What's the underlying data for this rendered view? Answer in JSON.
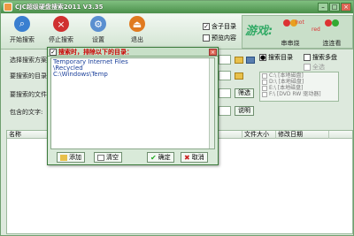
{
  "window": {
    "title": "CJC超级硬盘搜索2011 V3.35",
    "min": "–",
    "max": "□",
    "close": "×"
  },
  "toolbar": {
    "start": "开始搜索",
    "stop": "停止搜索",
    "settings": "设置",
    "exit": "退出"
  },
  "options": {
    "subdir": "含子目录",
    "preview": "预览内容"
  },
  "games": {
    "title": "游戏:",
    "item1": "串串烧",
    "item2": "连连看",
    "hot_badge": "hot",
    "red_badge": "red"
  },
  "form": {
    "scheme_label": "选择搜索方案:",
    "dir_label": "要搜索的目录:",
    "file_label": "要搜索的文件:",
    "text_label": "包含的文字:",
    "filter_btn": "筛选",
    "explain_btn": "说明"
  },
  "right": {
    "search_dir": "搜索目录",
    "search_multi": "搜索多盘",
    "select_all": "全选",
    "drives": [
      "C:\\ [本地磁盘]",
      "D:\\ [本地磁盘]",
      "E:\\ [本地磁盘]",
      "F:\\ [DVD RW 驱动器]"
    ]
  },
  "results": {
    "col_name": "名称",
    "col_size": "文件大小",
    "col_date": "修改日期"
  },
  "dialog": {
    "title": "搜索时，排除以下的目录：",
    "lines": [
      "Temporary Internet Files",
      "\\Recycled",
      "C:\\Windows\\Temp"
    ],
    "add": "添加",
    "clear": "清空",
    "ok": "确定",
    "cancel": "取消"
  },
  "colors": {
    "accent": "#4a8f4a",
    "dialog_title": "#cc0000"
  }
}
